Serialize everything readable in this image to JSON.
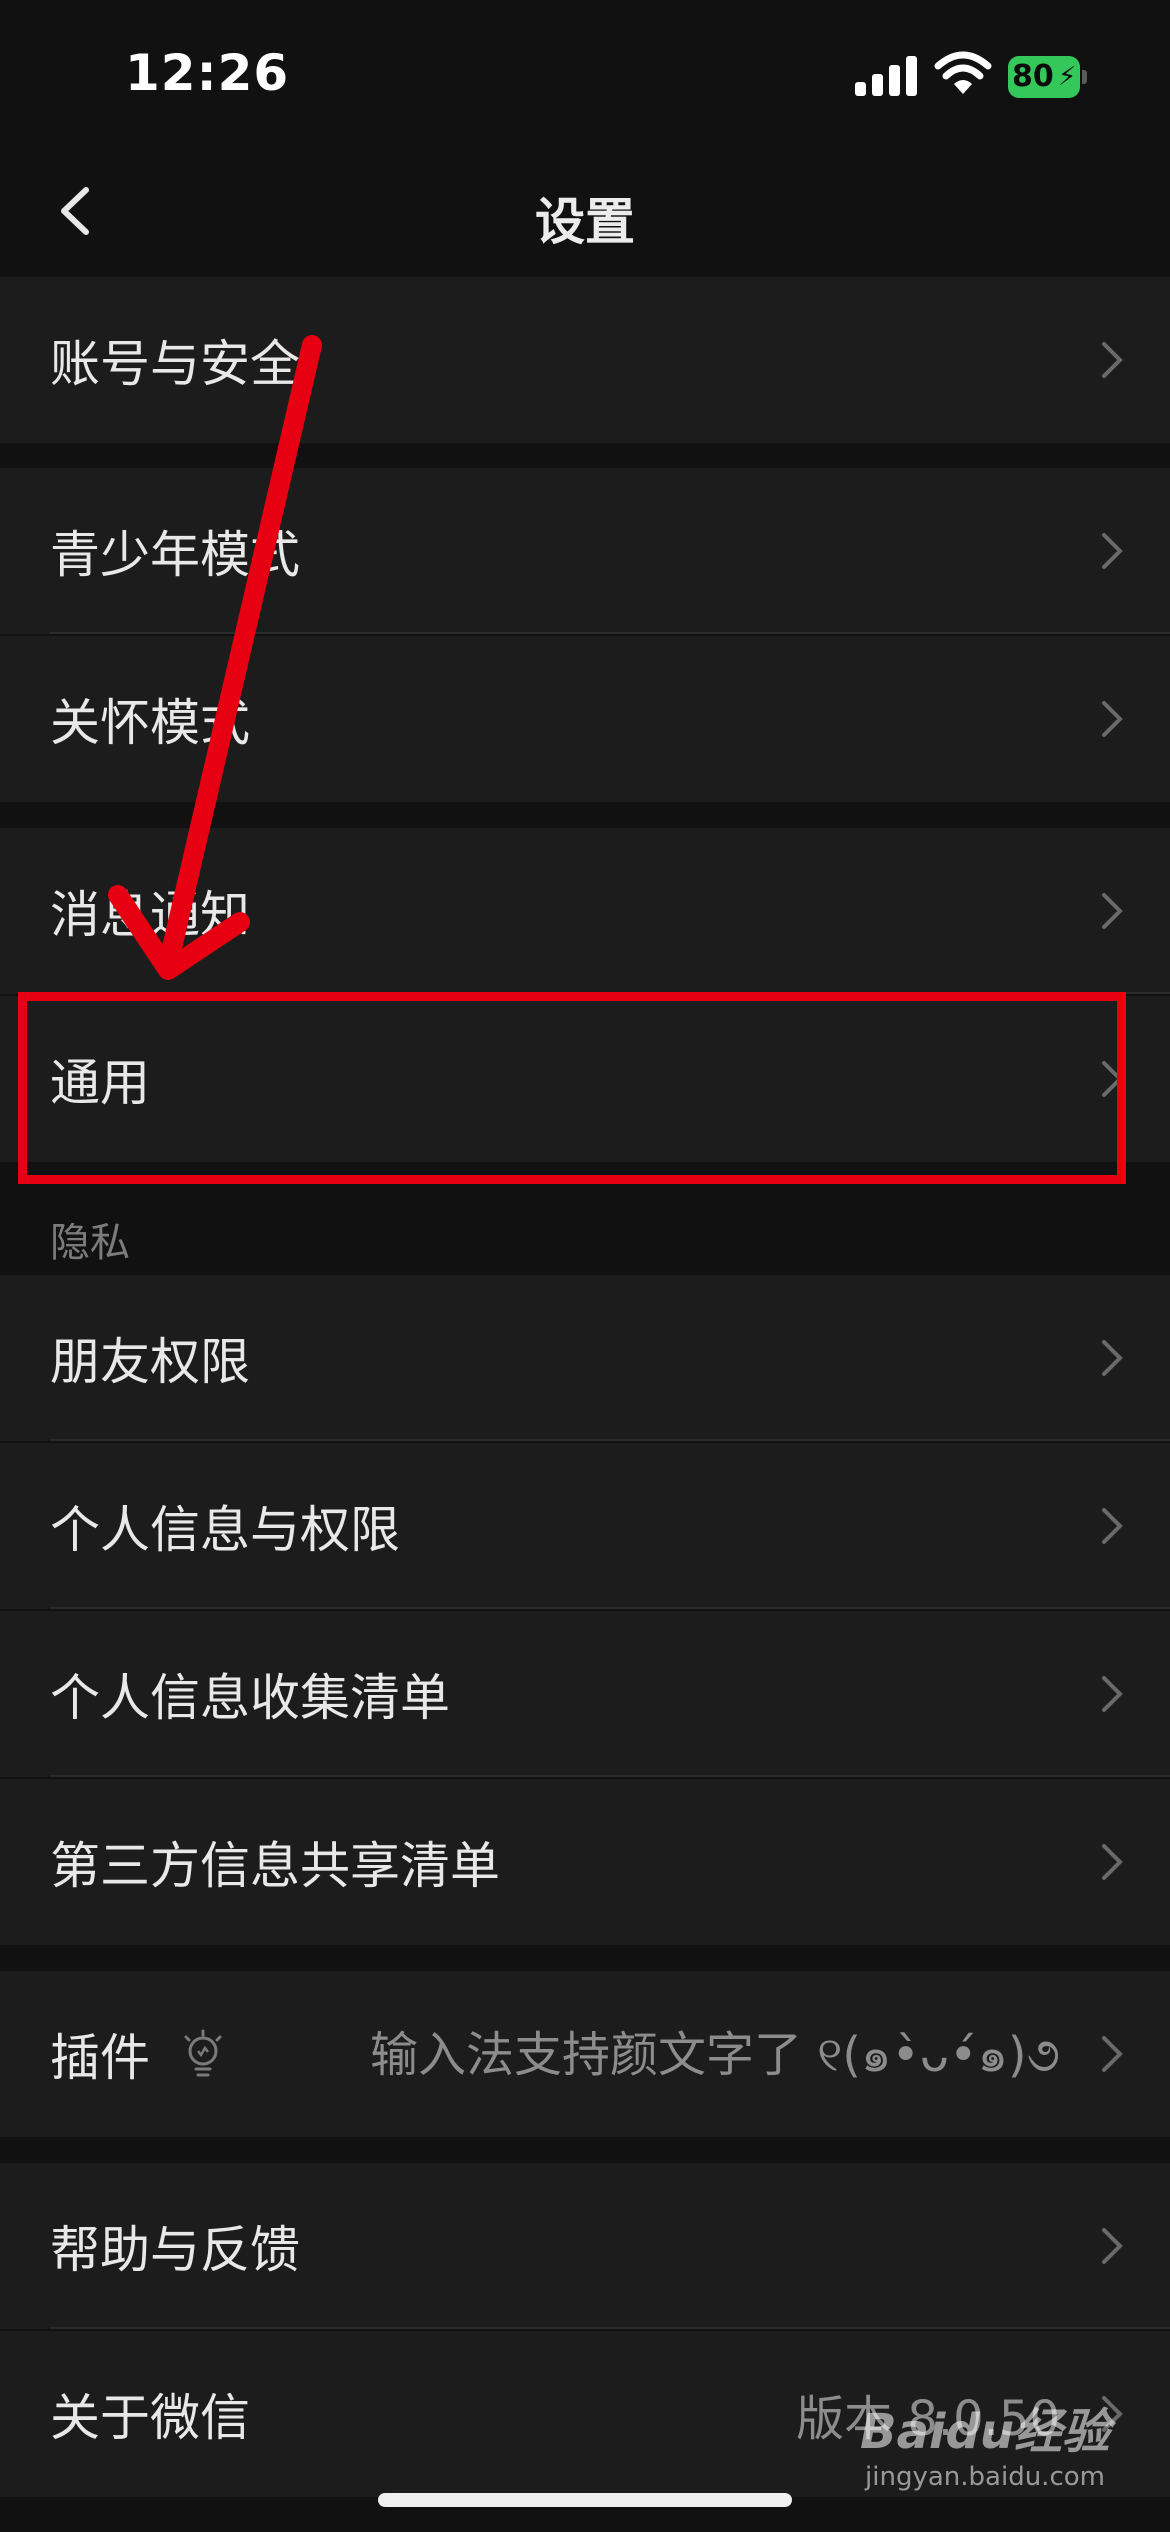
{
  "status_bar": {
    "time": "12:26",
    "battery": "80"
  },
  "nav": {
    "title": "设置"
  },
  "rows": {
    "account": {
      "label": "账号与安全"
    },
    "youth": {
      "label": "青少年模式"
    },
    "care": {
      "label": "关怀模式"
    },
    "notify": {
      "label": "消息通知"
    },
    "general": {
      "label": "通用"
    },
    "friends": {
      "label": "朋友权限"
    },
    "personal_info": {
      "label": "个人信息与权限"
    },
    "info_collect": {
      "label": "个人信息收集清单"
    },
    "third_party": {
      "label": "第三方信息共享清单"
    },
    "plugins": {
      "label": "插件",
      "value": "输入法支持颜文字了 ୧(๑•̀ᴗ•́๑)૭"
    },
    "help": {
      "label": "帮助与反馈"
    },
    "about": {
      "label": "关于微信",
      "value": "版本 8.0.50"
    }
  },
  "sections": {
    "privacy": "隐私"
  },
  "watermark": {
    "logo": "Baidu经验",
    "url": "jingyan.baidu.com"
  },
  "colors": {
    "background": "#111111",
    "row": "#1c1c1c",
    "highlight": "#e60012",
    "battery": "#34c759"
  }
}
